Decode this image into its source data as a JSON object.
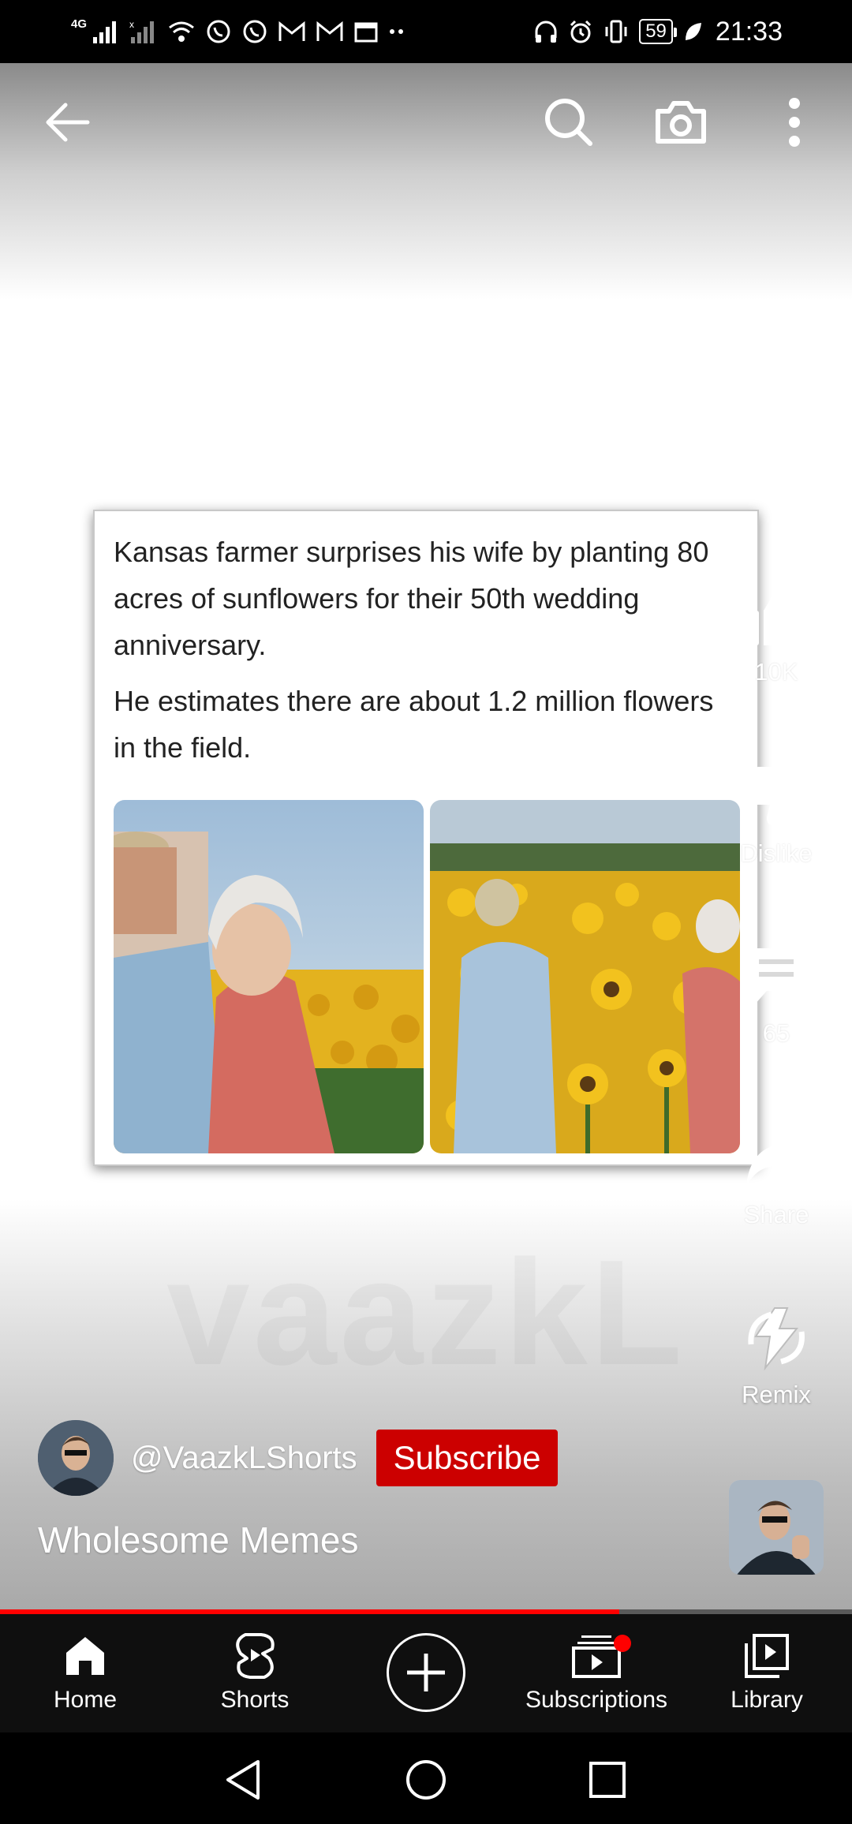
{
  "status_bar": {
    "network": "4G",
    "battery": "59",
    "time": "21:33"
  },
  "top_bar": {
    "icons": [
      "back-arrow-icon",
      "search-icon",
      "camera-icon",
      "more-vert-icon"
    ]
  },
  "watermark": "vaazkL",
  "meme": {
    "headline": "Kansas farmer surprises his wife by planting 80 acres of sunflowers for their 50th wedding anniversary.",
    "subline": "He estimates there are about 1.2 million flowers in the field."
  },
  "actions": {
    "like_label": "10K",
    "dislike_label": "Dislike",
    "comments_label": "65",
    "share_label": "Share",
    "remix_label": "Remix"
  },
  "channel": {
    "handle": "@VaazkLShorts",
    "subscribe_label": "Subscribe"
  },
  "video": {
    "title": "Wholesome Memes",
    "progress": 0.727
  },
  "bottom_nav": {
    "home": "Home",
    "shorts": "Shorts",
    "subscriptions": "Subscriptions",
    "library": "Library"
  },
  "colors": {
    "accent": "#ff0000",
    "subscribe": "#cc0000",
    "nav_bg": "#0f0f0f"
  }
}
